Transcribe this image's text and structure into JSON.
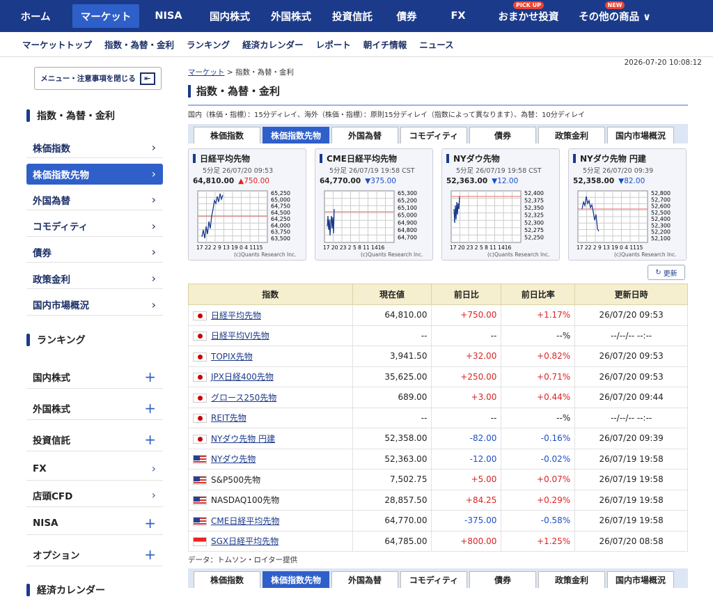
{
  "global_nav": [
    {
      "label": "ホーム",
      "w": 74,
      "badge": ""
    },
    {
      "label": "マーケット",
      "w": 96,
      "badge": "",
      "active": true
    },
    {
      "label": "NISA",
      "w": 84,
      "badge": ""
    },
    {
      "label": "国内株式",
      "w": 92,
      "badge": ""
    },
    {
      "label": "外国株式",
      "w": 84,
      "badge": ""
    },
    {
      "label": "投資信託",
      "w": 92,
      "badge": ""
    },
    {
      "label": "債券",
      "w": 64,
      "badge": ""
    },
    {
      "label": "FX",
      "w": 84,
      "badge": ""
    },
    {
      "label": "おまかせ投資",
      "w": 118,
      "badge": "PICK UP"
    },
    {
      "label": "その他の商品 ∨",
      "w": 130,
      "badge": "NEW"
    }
  ],
  "sub_nav": [
    "マーケットトップ",
    "指数・為替・金利",
    "ランキング",
    "経済カレンダー",
    "レポート",
    "朝イチ情報",
    "ニュース"
  ],
  "timestamp": "2026-07-20 10:08:12",
  "sidebar": {
    "close_label": "メニュー・注意事項を閉じる",
    "close_icon": "⇤",
    "section1": "指数・為替・金利",
    "items1": [
      "株価指数",
      "株価指数先物",
      "外国為替",
      "コモディティ",
      "債券",
      "政策金利",
      "国内市場概況"
    ],
    "section2": "ランキング",
    "items2": [
      {
        "label": "国内株式",
        "mark": "+"
      },
      {
        "label": "外国株式",
        "mark": "+"
      },
      {
        "label": "投資信託",
        "mark": "+"
      },
      {
        "label": "FX",
        "mark": "›"
      },
      {
        "label": "店頭CFD",
        "mark": "›"
      },
      {
        "label": "NISA",
        "mark": "+"
      },
      {
        "label": "オプション",
        "mark": "+"
      }
    ],
    "section3": "経済カレンダー"
  },
  "breadcrumb": {
    "link": "マーケット",
    "rest": " > 指数・為替・金利"
  },
  "page_title": "指数・為替・金利",
  "delay_note": "国内（株価・指標）：15分ディレイ、海外（株価・指標）：原則15分ディレイ（指数によって異なります）、為替：10分ディレイ",
  "tabs": [
    "株価指数",
    "株価指数先物",
    "外国為替",
    "コモディティ",
    "債券",
    "政策金利",
    "国内市場概況"
  ],
  "active_tab": 1,
  "cards": [
    {
      "title": "日経平均先物",
      "sub": "5分足 26/07/20 09:53",
      "value": "64,810.00",
      "change": "▲750.00",
      "dir": "up",
      "yticks": [
        "65,250",
        "65,000",
        "64,750",
        "64,500",
        "64,250",
        "64,000",
        "63,750",
        "63,500"
      ],
      "xticks": "17 22 2  9 13 19 0  4 1115",
      "credit": "(c)Quants Research Inc."
    },
    {
      "title": "CME日経平均先物",
      "sub": "5分足 26/07/19 19:58 CST",
      "value": "64,770.00",
      "change": "▼375.00",
      "dir": "down",
      "yticks": [
        "65,300",
        "65,200",
        "65,100",
        "65,000",
        "64,900",
        "64,800",
        "64,700"
      ],
      "xticks": "17 20 23 2  5  8 11 1416",
      "credit": "(c)Quants Research Inc."
    },
    {
      "title": "NYダウ先物",
      "sub": "5分足 26/07/19 19:58 CST",
      "value": "52,363.00",
      "change": "▼12.00",
      "dir": "down",
      "yticks": [
        "52,400",
        "52,375",
        "52,350",
        "52,325",
        "52,300",
        "52,275",
        "52,250"
      ],
      "xticks": "17 20 23 2  5  8 11 1416",
      "credit": "(c)Quants Research Inc."
    },
    {
      "title": "NYダウ先物 円建",
      "sub": "5分足 26/07/20 09:39",
      "value": "52,358.00",
      "change": "▼82.00",
      "dir": "down",
      "yticks": [
        "52,800",
        "52,700",
        "52,600",
        "52,500",
        "52,400",
        "52,300",
        "52,200",
        "52,100"
      ],
      "xticks": "17 22 2  9 13 19 0  4 1115",
      "credit": "(c)Quants Research Inc."
    }
  ],
  "reload_label": "更新",
  "table": {
    "headers": [
      "指数",
      "現在値",
      "前日比",
      "前日比率",
      "更新日時"
    ],
    "rows": [
      {
        "flag": "jp",
        "name": "日経平均先物",
        "link": true,
        "price": "64,810.00",
        "chg": "+750.00",
        "pct": "+1.17%",
        "time": "26/07/20 09:53",
        "dir": "pos"
      },
      {
        "flag": "jp",
        "name": "日経平均VI先物",
        "link": true,
        "price": "--",
        "chg": "--",
        "pct": "--%",
        "time": "--/--/-- --:--",
        "dir": ""
      },
      {
        "flag": "jp",
        "name": "TOPIX先物",
        "link": true,
        "price": "3,941.50",
        "chg": "+32.00",
        "pct": "+0.82%",
        "time": "26/07/20 09:53",
        "dir": "pos"
      },
      {
        "flag": "jp",
        "name": "JPX日経400先物",
        "link": true,
        "price": "35,625.00",
        "chg": "+250.00",
        "pct": "+0.71%",
        "time": "26/07/20 09:53",
        "dir": "pos"
      },
      {
        "flag": "jp",
        "name": "グロース250先物",
        "link": true,
        "price": "689.00",
        "chg": "+3.00",
        "pct": "+0.44%",
        "time": "26/07/20 09:44",
        "dir": "pos"
      },
      {
        "flag": "jp",
        "name": "REIT先物",
        "link": true,
        "price": "--",
        "chg": "--",
        "pct": "--%",
        "time": "--/--/-- --:--",
        "dir": ""
      },
      {
        "flag": "jp",
        "name": "NYダウ先物 円建",
        "link": true,
        "price": "52,358.00",
        "chg": "-82.00",
        "pct": "-0.16%",
        "time": "26/07/20 09:39",
        "dir": "neg"
      },
      {
        "flag": "us",
        "name": "NYダウ先物",
        "link": true,
        "price": "52,363.00",
        "chg": "-12.00",
        "pct": "-0.02%",
        "time": "26/07/19 19:58",
        "dir": "neg"
      },
      {
        "flag": "us",
        "name": "S&P500先物",
        "link": false,
        "price": "7,502.75",
        "chg": "+5.00",
        "pct": "+0.07%",
        "time": "26/07/19 19:58",
        "dir": "pos"
      },
      {
        "flag": "us",
        "name": "NASDAQ100先物",
        "link": false,
        "price": "28,857.50",
        "chg": "+84.25",
        "pct": "+0.29%",
        "time": "26/07/19 19:58",
        "dir": "pos"
      },
      {
        "flag": "us",
        "name": "CME日経平均先物",
        "link": true,
        "price": "64,770.00",
        "chg": "-375.00",
        "pct": "-0.58%",
        "time": "26/07/19 19:58",
        "dir": "neg"
      },
      {
        "flag": "sg",
        "name": "SGX日経平均先物",
        "link": true,
        "price": "64,785.00",
        "chg": "+800.00",
        "pct": "+1.25%",
        "time": "26/07/20 08:58",
        "dir": "pos"
      }
    ]
  },
  "source_note": "データ：トムソン・ロイター提供"
}
